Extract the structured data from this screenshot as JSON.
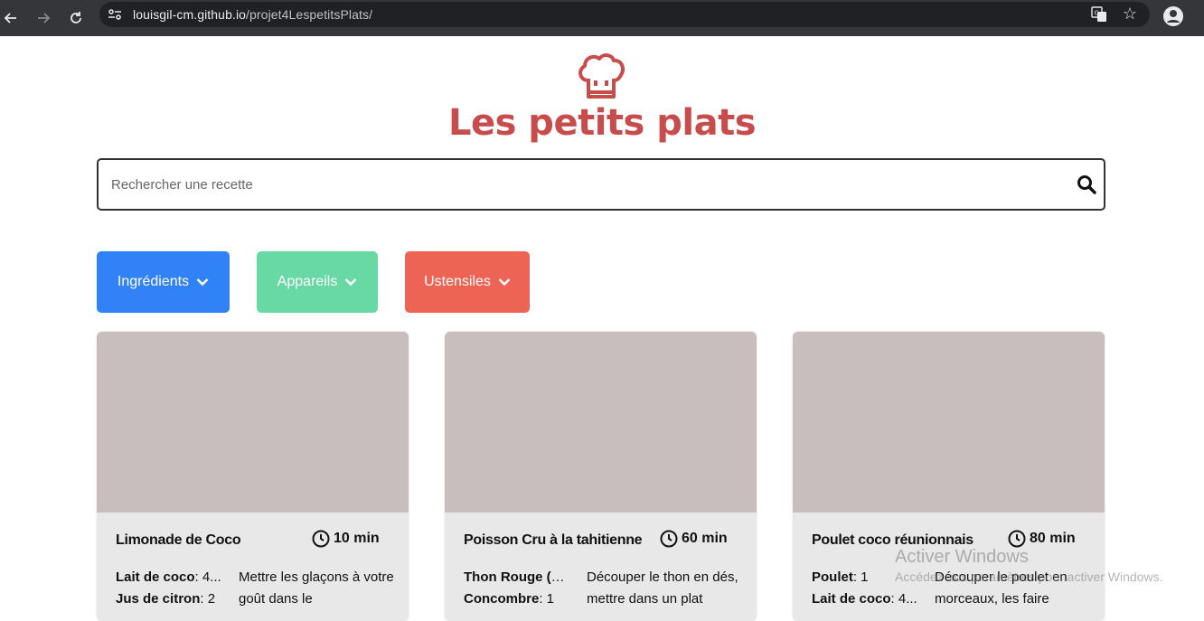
{
  "browser": {
    "url_host": "louisgil-cm.github.io",
    "url_path": "/projet4LespetitsPlats/"
  },
  "header": {
    "title": "Les petits plats",
    "logo_icon": "chef-hat-icon"
  },
  "search": {
    "placeholder": "Rechercher une recette"
  },
  "filters": [
    {
      "label": "Ingrédients",
      "color": "#3282f7"
    },
    {
      "label": "Appareils",
      "color": "#68d9a4"
    },
    {
      "label": "Ustensiles",
      "color": "#ed6454"
    }
  ],
  "recipes": [
    {
      "name": "Limonade de Coco",
      "time": "10 min",
      "ingredients": [
        {
          "name": "Lait de coco",
          "qty": ": 4..."
        },
        {
          "name": "Jus de citron",
          "qty": ": 2"
        }
      ],
      "description": "Mettre les glaçons à votre goût dans le"
    },
    {
      "name": "Poisson Cru à la tahitienne",
      "time": "60 min",
      "ingredients": [
        {
          "name": "Thon Rouge (o...",
          "qty": ""
        },
        {
          "name": "Concombre",
          "qty": ": 1"
        }
      ],
      "description": "Découper le thon en dés, mettre dans un plat"
    },
    {
      "name": "Poulet coco réunionnais",
      "time": "80 min",
      "ingredients": [
        {
          "name": "Poulet",
          "qty": ": 1"
        },
        {
          "name": "Lait de coco",
          "qty": ": 4..."
        }
      ],
      "description": "Découper le poulet en morceaux, les faire"
    }
  ],
  "os_watermark": {
    "title": "Activer Windows",
    "subtitle": "Accédez aux paramètres pour activer Windows."
  }
}
